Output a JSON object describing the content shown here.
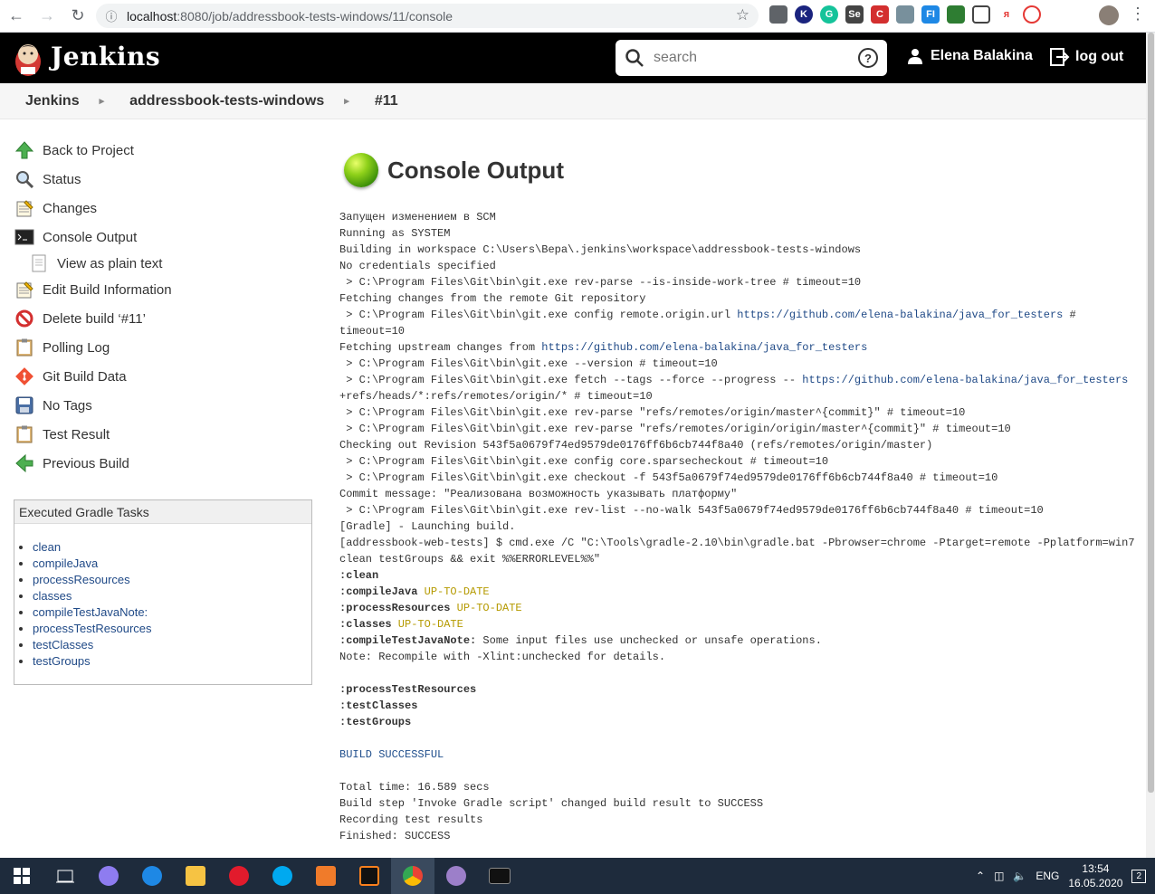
{
  "browser": {
    "url_host": "localhost",
    "url_path": ":8080/job/addressbook-tests-windows/11/console",
    "back_icon": "arrow-left-icon",
    "forward_icon": "arrow-right-icon",
    "reload_icon": "reload-icon"
  },
  "header": {
    "brand": "Jenkins",
    "search_placeholder": "search",
    "help_label": "?",
    "user_name": "Elena Balakina",
    "logout_label": "log out"
  },
  "breadcrumb": [
    "Jenkins",
    "addressbook-tests-windows",
    "#11"
  ],
  "sidebar": {
    "items": [
      {
        "label": "Back to Project",
        "icon": "arrow-up-icon"
      },
      {
        "label": "Status",
        "icon": "magnifier-icon"
      },
      {
        "label": "Changes",
        "icon": "notepad-icon"
      },
      {
        "label": "Console Output",
        "icon": "terminal-icon"
      },
      {
        "label": "View as plain text",
        "icon": "document-icon"
      },
      {
        "label": "Edit Build Information",
        "icon": "notepad-icon"
      },
      {
        "label": "Delete build ‘#11’",
        "icon": "no-entry-icon"
      },
      {
        "label": "Polling Log",
        "icon": "clipboard-icon"
      },
      {
        "label": "Git Build Data",
        "icon": "git-icon"
      },
      {
        "label": "No Tags",
        "icon": "save-icon"
      },
      {
        "label": "Test Result",
        "icon": "clipboard-icon"
      },
      {
        "label": "Previous Build",
        "icon": "arrow-left-green-icon"
      }
    ]
  },
  "gradle_tasks": {
    "title": "Executed Gradle Tasks",
    "items": [
      "clean",
      "compileJava",
      "processResources",
      "classes",
      "compileTestJavaNote:",
      "processTestResources",
      "testClasses",
      "testGroups"
    ]
  },
  "main": {
    "title": "Console Output",
    "status_color": "#6cc021"
  },
  "console": [
    {
      "t": "Запущен изменением в SCM"
    },
    {
      "t": "Running as SYSTEM"
    },
    {
      "t": "Building in workspace C:\\Users\\Вера\\.jenkins\\workspace\\addressbook-tests-windows"
    },
    {
      "t": "No credentials specified"
    },
    {
      "t": " > C:\\Program Files\\Git\\bin\\git.exe rev-parse --is-inside-work-tree # timeout=10"
    },
    {
      "t": "Fetching changes from the remote Git repository"
    },
    {
      "t": " > C:\\Program Files\\Git\\bin\\git.exe config remote.origin.url ",
      "link": "https://github.com/elena-balakina/java_for_testers",
      "after": " #"
    },
    {
      "t": "timeout=10"
    },
    {
      "t": "Fetching upstream changes from ",
      "link": "https://github.com/elena-balakina/java_for_testers"
    },
    {
      "t": " > C:\\Program Files\\Git\\bin\\git.exe --version # timeout=10"
    },
    {
      "t": " > C:\\Program Files\\Git\\bin\\git.exe fetch --tags --force --progress -- ",
      "link": "https://github.com/elena-balakina/java_for_testers"
    },
    {
      "t": "+refs/heads/*:refs/remotes/origin/* # timeout=10"
    },
    {
      "t": " > C:\\Program Files\\Git\\bin\\git.exe rev-parse \"refs/remotes/origin/master^{commit}\" # timeout=10"
    },
    {
      "t": " > C:\\Program Files\\Git\\bin\\git.exe rev-parse \"refs/remotes/origin/origin/master^{commit}\" # timeout=10"
    },
    {
      "t": "Checking out Revision 543f5a0679f74ed9579de0176ff6b6cb744f8a40 (refs/remotes/origin/master)"
    },
    {
      "t": " > C:\\Program Files\\Git\\bin\\git.exe config core.sparsecheckout # timeout=10"
    },
    {
      "t": " > C:\\Program Files\\Git\\bin\\git.exe checkout -f 543f5a0679f74ed9579de0176ff6b6cb744f8a40 # timeout=10"
    },
    {
      "t": "Commit message: \"Реализована возможность указывать платформу\""
    },
    {
      "t": " > C:\\Program Files\\Git\\bin\\git.exe rev-list --no-walk 543f5a0679f74ed9579de0176ff6b6cb744f8a40 # timeout=10"
    },
    {
      "t": "[Gradle] - Launching build."
    },
    {
      "t": "[addressbook-web-tests] $ cmd.exe /C \"C:\\Tools\\gradle-2.10\\bin\\gradle.bat -Pbrowser=chrome -Ptarget=remote -Pplatform=win7"
    },
    {
      "t": "clean testGroups && exit %%ERRORLEVEL%%\""
    },
    {
      "bold": ":clean"
    },
    {
      "bold": ":compileJava",
      "hl": " UP-TO-DATE"
    },
    {
      "bold": ":processResources",
      "hl": " UP-TO-DATE"
    },
    {
      "bold": ":classes",
      "hl": " UP-TO-DATE"
    },
    {
      "bold": ":compileTestJavaNote:",
      "t": " Some input files use unchecked or unsafe operations."
    },
    {
      "t": "Note: Recompile with -Xlint:unchecked for details."
    },
    {
      "t": ""
    },
    {
      "bold": ":processTestResources"
    },
    {
      "bold": ":testClasses"
    },
    {
      "bold": ":testGroups"
    },
    {
      "t": ""
    },
    {
      "info": "BUILD SUCCESSFUL"
    },
    {
      "t": ""
    },
    {
      "t": "Total time: 16.589 secs"
    },
    {
      "t": "Build step 'Invoke Gradle script' changed build result to SUCCESS"
    },
    {
      "t": "Recording test results"
    },
    {
      "t": "Finished: SUCCESS"
    }
  ],
  "taskbar": {
    "lang": "ENG",
    "time": "13:54",
    "date": "16.05.2020",
    "notifications": "2"
  }
}
